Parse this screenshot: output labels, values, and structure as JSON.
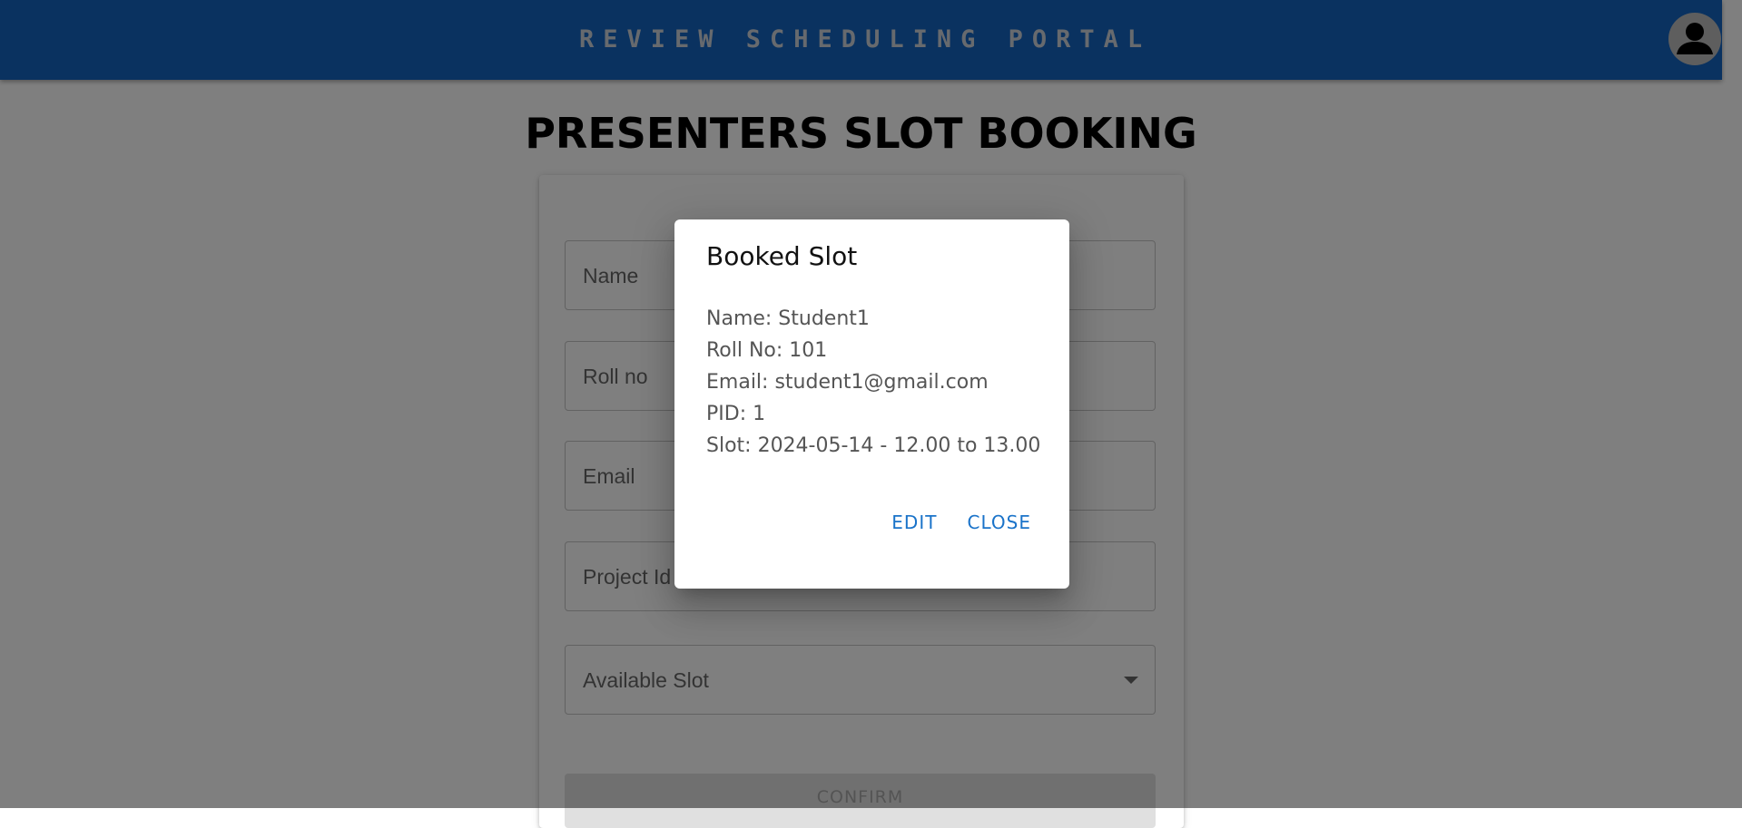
{
  "appbar": {
    "title": "REVIEW SCHEDULING PORTAL",
    "avatar_icon": "account-circle-icon"
  },
  "page": {
    "title": "PRESENTERS SLOT BOOKING"
  },
  "form": {
    "fields": [
      {
        "label": "Name"
      },
      {
        "label": "Roll no"
      },
      {
        "label": "Email"
      },
      {
        "label": "Project Id"
      },
      {
        "label": "Available Slot"
      }
    ],
    "confirm_label": "CONFIRM"
  },
  "dialog": {
    "title": "Booked Slot",
    "lines": [
      "Name: Student1",
      "Roll No: 101",
      "Email: student1@gmail.com",
      "PID: 1",
      "Slot: 2024-05-14 - 12.00 to 13.00"
    ],
    "edit_label": "EDIT",
    "close_label": "CLOSE"
  },
  "colors": {
    "appbar": "#1565c0",
    "dialog_action": "#1a73c9"
  }
}
